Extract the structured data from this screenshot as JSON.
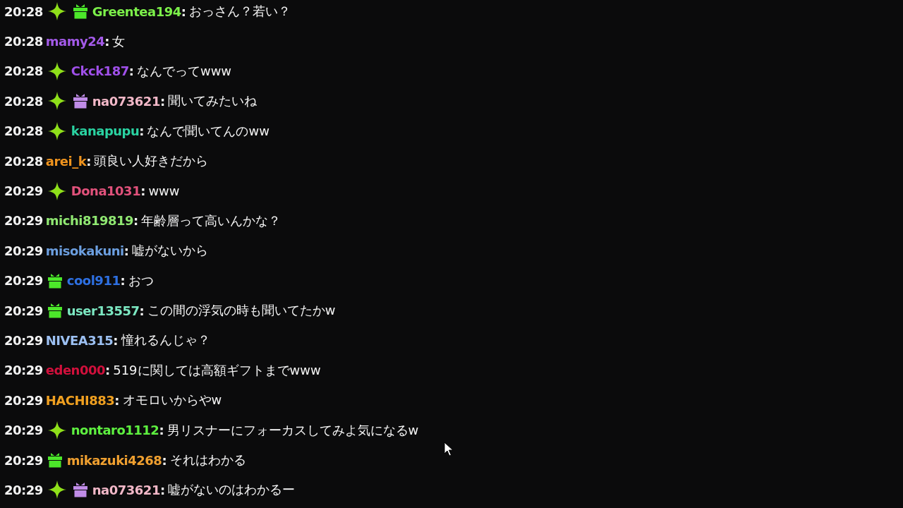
{
  "chat_messages": [
    {
      "time": "20:28",
      "badges": [
        {
          "kind": "sparkle"
        },
        {
          "kind": "gift",
          "color": "#4ce82a"
        }
      ],
      "user": "Greentea194",
      "separator": ":",
      "color": "#7cf04a",
      "text": "おっさん？若い？"
    },
    {
      "time": "20:28",
      "user": "mamy24",
      "separator": ":",
      "color": "#a35ae8",
      "text": "女"
    },
    {
      "time": "20:28",
      "badges": [
        {
          "kind": "sparkle"
        }
      ],
      "user": "Ckck187",
      "separator": ":",
      "color": "#a050ea",
      "text": "なんでってwww"
    },
    {
      "time": "20:28",
      "badges": [
        {
          "kind": "sparkle"
        },
        {
          "kind": "gift",
          "color": "#c08ce8"
        }
      ],
      "user": "na073621",
      "separator": ":",
      "color": "#f2b8c8",
      "text": "聞いてみたいね"
    },
    {
      "time": "20:28",
      "badges": [
        {
          "kind": "sparkle"
        }
      ],
      "user": "kanapupu",
      "separator": ":",
      "color": "#2ad3a2",
      "text": "なんで聞いてんのww"
    },
    {
      "time": "20:28",
      "user": "arei_k",
      "separator": ":",
      "color": "#f0941e",
      "text": "頭良い人好きだから"
    },
    {
      "time": "20:29",
      "badges": [
        {
          "kind": "sparkle"
        }
      ],
      "user": "Dona1031",
      "separator": ":",
      "color": "#e2527c",
      "text": "www"
    },
    {
      "time": "20:29",
      "user": "michi819819",
      "separator": ":",
      "color": "#90e872",
      "text": "年齢層って高いんかな？"
    },
    {
      "time": "20:29",
      "user": "misokakuni",
      "separator": ":",
      "color": "#6c9fe0",
      "text": "嘘がないから"
    },
    {
      "time": "20:29",
      "badges": [
        {
          "kind": "gift",
          "color": "#4ce82a"
        }
      ],
      "user": "cool911",
      "separator": ":",
      "color": "#2e70e2",
      "text": "おつ"
    },
    {
      "time": "20:29",
      "badges": [
        {
          "kind": "gift",
          "color": "#4ce82a"
        }
      ],
      "user": "user13557",
      "separator": ":",
      "color": "#7ce8c2",
      "text": "この間の浮気の時も聞いてたかw"
    },
    {
      "time": "20:29",
      "user": "NIVEA315",
      "separator": ":",
      "color": "#9cc0f2",
      "text": "憧れるんじゃ？"
    },
    {
      "time": "20:29",
      "user": "eden000",
      "separator": ":",
      "color": "#d2103c",
      "text": "519に関しては高額ギフトまでwww"
    },
    {
      "time": "20:29",
      "user": "HACHI883",
      "separator": ":",
      "color": "#f0a020",
      "text": "オモロいからやw"
    },
    {
      "time": "20:29",
      "badges": [
        {
          "kind": "sparkle"
        }
      ],
      "user": "nontaro1112",
      "separator": ":",
      "color": "#5ef040",
      "text": "男リスナーにフォーカスしてみよ気になるw"
    },
    {
      "time": "20:29",
      "badges": [
        {
          "kind": "gift",
          "color": "#4ce82a"
        }
      ],
      "user": "mikazuki4268",
      "separator": ":",
      "color": "#f0a030",
      "text": "それはわかる"
    },
    {
      "time": "20:29",
      "badges": [
        {
          "kind": "sparkle"
        },
        {
          "kind": "gift",
          "color": "#c08ce8"
        }
      ],
      "user": "na073621",
      "separator": ":",
      "color": "#f2b8c8",
      "text": "嘘がないのはわかるー"
    }
  ]
}
